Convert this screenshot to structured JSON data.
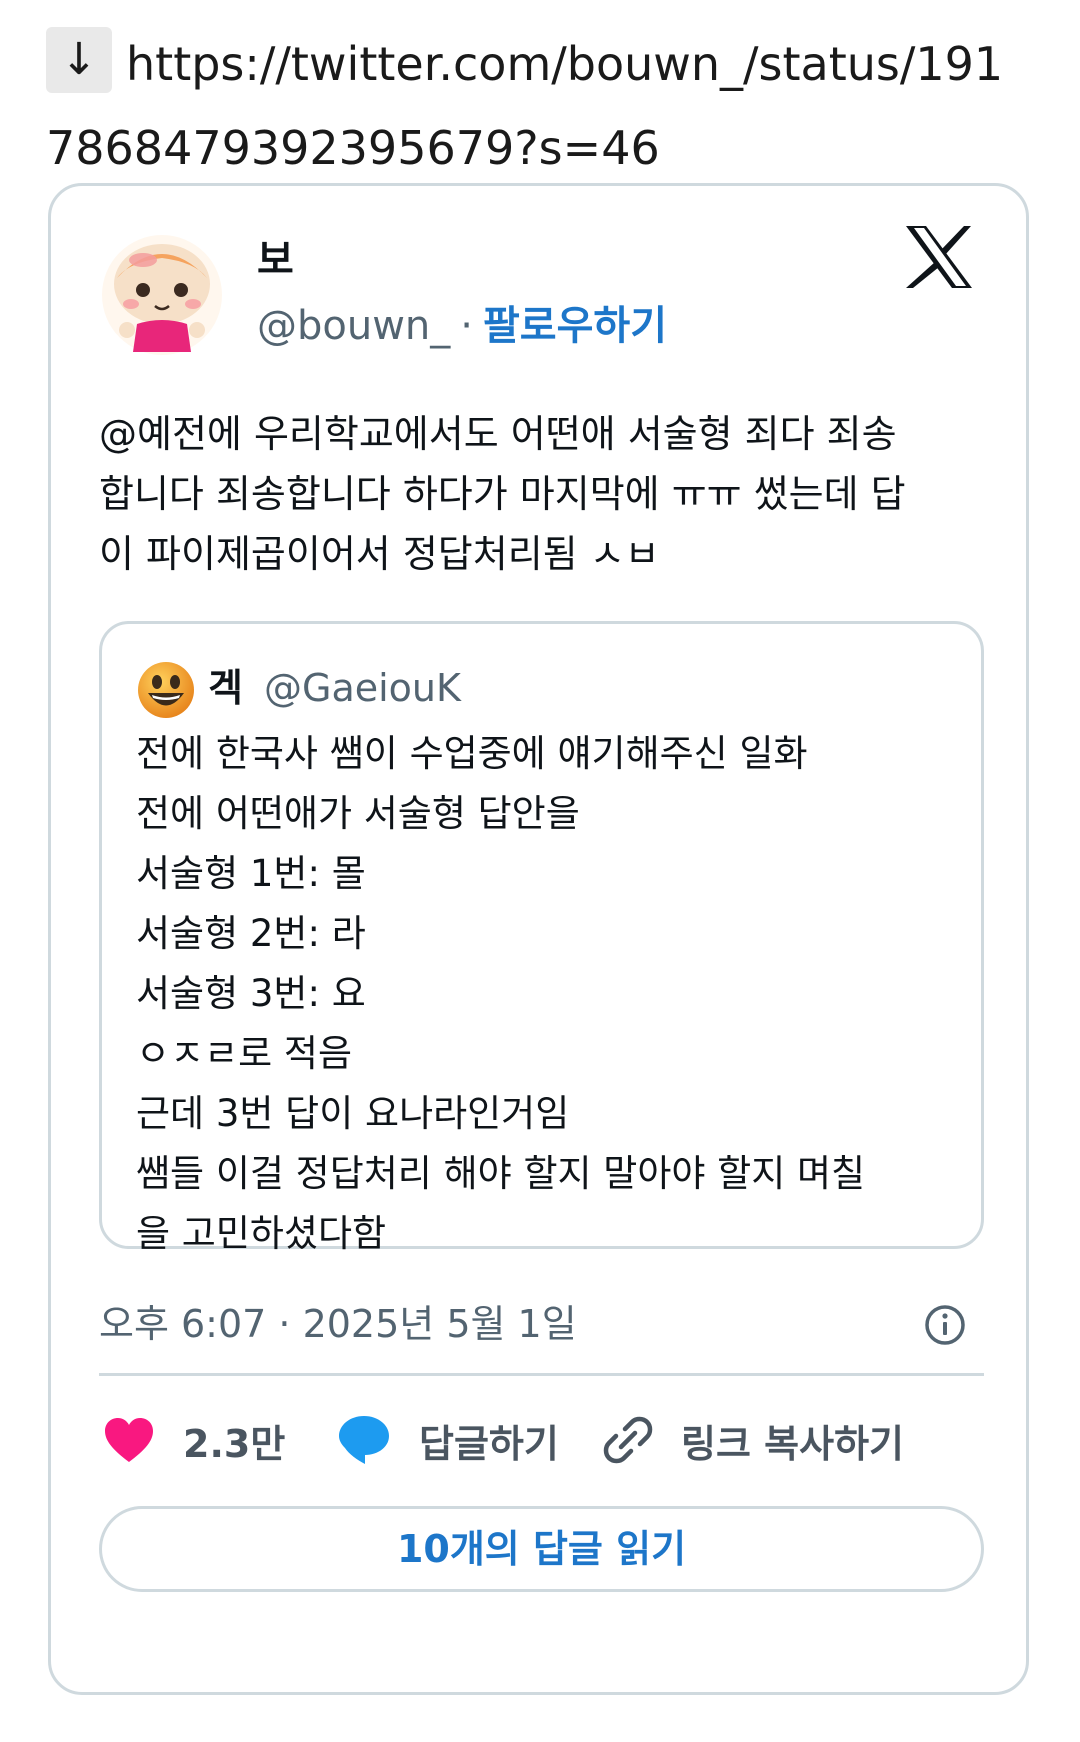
{
  "url_bar": {
    "arrow": "↓",
    "url": "https://twitter.com/bouwn_/status/1917868479392395679?s=46"
  },
  "tweet": {
    "display_name": "보",
    "handle": "@bouwn_",
    "separator": "·",
    "follow_label": "팔로우하기",
    "text": "@예전에 우리학교에서도 어떤애 서술형 죄다 죄송\n합니다 죄송합니다 하다가 마지막에 ㅠㅠ 썼는데 답\n이 파이제곱이어서 정답처리됨 ㅅㅂ",
    "quoted": {
      "display_name": "겍",
      "handle": "@GaeiouK",
      "text": "전에 한국사 쌤이 수업중에 얘기해주신 일화\n전에 어떤애가 서술형 답안을\n서술형 1번: 몰\n서술형 2번: 라\n서술형 3번: 요\nㅇㅈㄹ로 적음\n근데 3번 답이 요나라인거임\n쌤들 이걸 정답처리 해야 할지 말아야 할지 며칠\n을 고민하셨다함"
    },
    "timestamp": "오후 6:07 · 2025년 5월 1일",
    "actions": {
      "likes": "2.3만",
      "reply": "답글하기",
      "copy_link": "링크 복사하기"
    },
    "read_replies": "10개의 답글 읽기"
  },
  "icons": {
    "heart": "heart-icon",
    "reply": "speech-bubble-icon",
    "link": "link-icon",
    "info": "info-icon",
    "x_logo": "x-logo-icon"
  },
  "colors": {
    "accent": "#1d76c9",
    "heart": "#f91880",
    "reply_bubble": "#1d9bf0",
    "border": "#cfd9de",
    "secondary_text": "#536471"
  }
}
